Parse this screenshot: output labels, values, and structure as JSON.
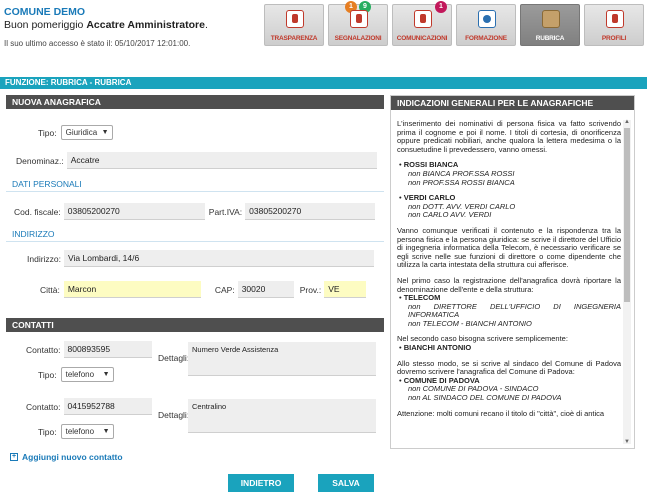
{
  "header": {
    "comune": "COMUNE DEMO",
    "greeting_prefix": "Buon pomeriggio ",
    "user": "Accatre Amministratore",
    "greeting_suffix": ".",
    "last_access": "Il suo ultimo accesso è stato il: 05/10/2017 12:01:00."
  },
  "nav": [
    {
      "label": "TRASPARENZA",
      "icon": "transparency-icon"
    },
    {
      "label": "SEGNALAZIONI",
      "icon": "report-icon",
      "badges": [
        "1",
        "9"
      ]
    },
    {
      "label": "COMUNICAZIONI",
      "icon": "communication-icon",
      "badges": [
        "1"
      ]
    },
    {
      "label": "FORMAZIONE",
      "icon": "training-icon"
    },
    {
      "label": "RUBRICA",
      "icon": "address-book-icon",
      "active": true
    },
    {
      "label": "PROFILI",
      "icon": "profile-icon"
    }
  ],
  "function_bar": "FUNZIONE: RUBRICA - RUBRICA",
  "form": {
    "section_title": "NUOVA ANAGRAFICA",
    "tipo_label": "Tipo:",
    "tipo_value": "Giuridica",
    "denominaz_label": "Denominaz.:",
    "denominaz_value": "Accatre",
    "dati_personali": "DATI PERSONALI",
    "cod_fiscale_label": "Cod. fiscale:",
    "cod_fiscale_value": "03805200270",
    "partiva_label": "Part.IVA:",
    "partiva_value": "03805200270",
    "indirizzo_section": "INDIRIZZO",
    "indirizzo_label": "Indirizzo:",
    "indirizzo_value": "Via Lombardi, 14/6",
    "citta_label": "Città:",
    "citta_value": "Marcon",
    "cap_label": "CAP:",
    "cap_value": "30020",
    "prov_label": "Prov.:",
    "prov_value": "VE"
  },
  "contatti": {
    "section_title": "CONTATTI",
    "contatto_label": "Contatto:",
    "dettagli_label": "Dettagli:",
    "tipo_label": "Tipo:",
    "items": [
      {
        "value": "800893595",
        "tipo": "telefono",
        "dettagli": "Numero Verde Assistenza"
      },
      {
        "value": "0415952788",
        "tipo": "telefono",
        "dettagli": "Centralino"
      }
    ],
    "add_link": "Aggiungi nuovo contatto"
  },
  "buttons": {
    "back": "INDIETRO",
    "save": "SALVA"
  },
  "info": {
    "title": "INDICAZIONI GENERALI PER LE ANAGRAFICHE",
    "p1": "L'inserimento dei nominativi di persona fisica va fatto scrivendo prima il cognome e poi il nome. I titoli di cortesia, di onorificenza oppure predicati nobiliari, anche qualora la lettera medesima o la consuetudine li prevedessero, vanno omessi.",
    "b1": "ROSSI BIANCA",
    "b1_s1": "non BIANCA PROF.SSA ROSSI",
    "b1_s2": "non PROF.SSA ROSSI BIANCA",
    "b2": "VERDI CARLO",
    "b2_s1": "non DOTT. AVV. VERDI CARLO",
    "b2_s2": "non CARLO AVV. VERDI",
    "p2": "Vanno comunque verificati il contenuto e la rispondenza tra la persona fisica e la persona giuridica: se scrive il direttore del Ufficio di ingegneria informatica della Telecom, è necessario verificare se egli scrive nelle sue funzioni di direttore o come dipendente che utilizza la carta intestata della struttura cui afferisce.",
    "p3": "Nel primo caso la registrazione dell'anagrafica dovrà riportare la denominazione dell'ente e della struttura:",
    "b3": "TELECOM",
    "b3_s1": "non DIRETTORE DELL'UFFICIO DI INGEGNERIA INFORMATICA",
    "b3_s2": "non TELECOM - BIANCHI ANTONIO",
    "p4": "Nel secondo caso bisogna scrivere semplicemente:",
    "b4": "BIANCHI ANTONIO",
    "p5": "Allo stesso modo, se si scrive al sindaco del Comune di Padova dovremo scrivere l'anagrafica del Comune di Padova:",
    "b5": "COMUNE DI PADOVA",
    "b5_s1": "non COMUNE DI PADOVA - SINDACO",
    "b5_s2": "non AL SINDACO DEL COMUNE DI PADOVA",
    "p6": "Attenzione: molti comuni recano il titolo di \"città\", cioè di antica"
  }
}
